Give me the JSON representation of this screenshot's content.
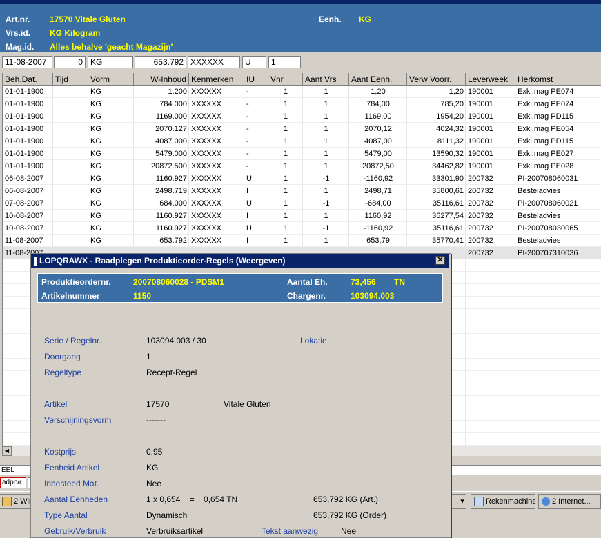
{
  "header": {
    "artnr_label": "Art.nr.",
    "artnr_value": "17570  Vitale Gluten",
    "eenh_label": "Eenh.",
    "eenh_value": "KG",
    "vrsid_label": "Vrs.id.",
    "vrsid_value": "KG  Kilogram",
    "magid_label": "Mag.id.",
    "magid_value": "Alles behalve 'geacht Magazijn'"
  },
  "filter": {
    "date": "11-08-2007",
    "time": "0",
    "unit": "KG",
    "amount": "653.792",
    "remarks": "XXXXXX",
    "io": "U",
    "vnr": "1"
  },
  "grid": {
    "columns": [
      "Beh.Dat.",
      "Tijd",
      "Vorm",
      "W-Inhoud",
      "Kenmerken",
      "IU",
      "Vnr",
      "Aant Vrs",
      "Aant Eenh.",
      "Verw Voorr.",
      "Leverweek",
      "Herkomst"
    ],
    "rows": [
      [
        "01-01-1900",
        "",
        "KG",
        "1.200",
        "XXXXXX",
        "-",
        "1",
        "1",
        "1,20",
        "1,20",
        "190001",
        "Exkl.mag PE074"
      ],
      [
        "01-01-1900",
        "",
        "KG",
        "784.000",
        "XXXXXX",
        "-",
        "1",
        "1",
        "784,00",
        "785,20",
        "190001",
        "Exkl.mag PE074"
      ],
      [
        "01-01-1900",
        "",
        "KG",
        "1169.000",
        "XXXXXX",
        "-",
        "1",
        "1",
        "1169,00",
        "1954,20",
        "190001",
        "Exkl.mag PD115"
      ],
      [
        "01-01-1900",
        "",
        "KG",
        "2070.127",
        "XXXXXX",
        "-",
        "1",
        "1",
        "2070,12",
        "4024,32",
        "190001",
        "Exkl.mag PE054"
      ],
      [
        "01-01-1900",
        "",
        "KG",
        "4087.000",
        "XXXXXX",
        "-",
        "1",
        "1",
        "4087,00",
        "8111,32",
        "190001",
        "Exkl.mag PD115"
      ],
      [
        "01-01-1900",
        "",
        "KG",
        "5479.000",
        "XXXXXX",
        "-",
        "1",
        "1",
        "5479,00",
        "13590,32",
        "190001",
        "Exkl.mag PE027"
      ],
      [
        "01-01-1900",
        "",
        "KG",
        "20872.500",
        "XXXXXX",
        "-",
        "1",
        "1",
        "20872,50",
        "34462,82",
        "190001",
        "Exkl.mag PE028"
      ],
      [
        "06-08-2007",
        "",
        "KG",
        "1160.927",
        "XXXXXX",
        "U",
        "1",
        "-1",
        "-1160,92",
        "33301,90",
        "200732",
        "PI-200708060031"
      ],
      [
        "06-08-2007",
        "",
        "KG",
        "2498.719",
        "XXXXXX",
        "I",
        "1",
        "1",
        "2498,71",
        "35800,61",
        "200732",
        "Besteladvies"
      ],
      [
        "07-08-2007",
        "",
        "KG",
        "684.000",
        "XXXXXX",
        "U",
        "1",
        "-1",
        "-684,00",
        "35116,61",
        "200732",
        "PI-200708060021"
      ],
      [
        "10-08-2007",
        "",
        "KG",
        "1160.927",
        "XXXXXX",
        "I",
        "1",
        "1",
        "1160,92",
        "36277,54",
        "200732",
        "Besteladvies"
      ],
      [
        "10-08-2007",
        "",
        "KG",
        "1160.927",
        "XXXXXX",
        "U",
        "1",
        "-1",
        "-1160,92",
        "35116,61",
        "200732",
        "PI-200708030065"
      ],
      [
        "11-08-2007",
        "",
        "KG",
        "653.792",
        "XXXXXX",
        "I",
        "1",
        "1",
        "653,79",
        "35770,41",
        "200732",
        "Besteladvies"
      ],
      [
        "11-08-2007",
        "",
        "",
        "",
        "",
        "",
        "",
        "",
        "",
        "",
        "200732",
        "PI-200707310036"
      ]
    ]
  },
  "strip": {
    "left_text": "EEL",
    "tab_text": "adprvr"
  },
  "taskbar": {
    "windows_btn": "2 Wind",
    "btn_rekenmachine": "Rekenmachine",
    "btn_internet": "2 Internet..."
  },
  "dialog": {
    "title": "LOPQRAWX - Raadplegen Produktieorder-Regels (Weergeven)",
    "close_glyph": "✕",
    "po_label": "Produktieordernr.",
    "po_value": "200708060028 - PDSM1",
    "aantal_label": "Aantal Eh.",
    "aantal_value": "73,456",
    "aantal_unit": "TN",
    "artnr_label": "Artikelnummer",
    "artnr_value": "1150",
    "charge_label": "Chargenr.",
    "charge_value": "103094.003",
    "fields": {
      "serie_label": "Serie / Regelnr.",
      "serie_value": "103094.003  / 30",
      "lokatie_label": "Lokatie",
      "doorgang_label": "Doorgang",
      "doorgang_value": "1",
      "regeltype_label": "Regeltype",
      "regeltype_value": "Recept-Regel",
      "artikel_label": "Artikel",
      "artikel_code": "17570",
      "artikel_name": "Vitale Gluten",
      "verschijning_label": "Verschijningsvorm",
      "verschijning_value": "-------",
      "kostprijs_label": "Kostprijs",
      "kostprijs_value": "0,95",
      "eenheid_label": "Eenheid Artikel",
      "eenheid_value": "KG",
      "inbesteed_label": "Inbesteed Mat.",
      "inbesteed_value": "Nee",
      "aantal_eenh_label": "Aantal Eenheden",
      "aantal_eenh_value": "1 x 0,654    =    0,654 TN",
      "aantal_eenh_art": "653,792 KG (Art.)",
      "type_aantal_label": "Type Aantal",
      "type_aantal_value": "Dynamisch",
      "type_aantal_order": "653,792 KG (Order)",
      "gebruik_label": "Gebruik/Verbruik",
      "gebruik_value": "Verbruiksartikel",
      "tekst_label": "Tekst aanwezig",
      "tekst_value": "Nee"
    }
  }
}
